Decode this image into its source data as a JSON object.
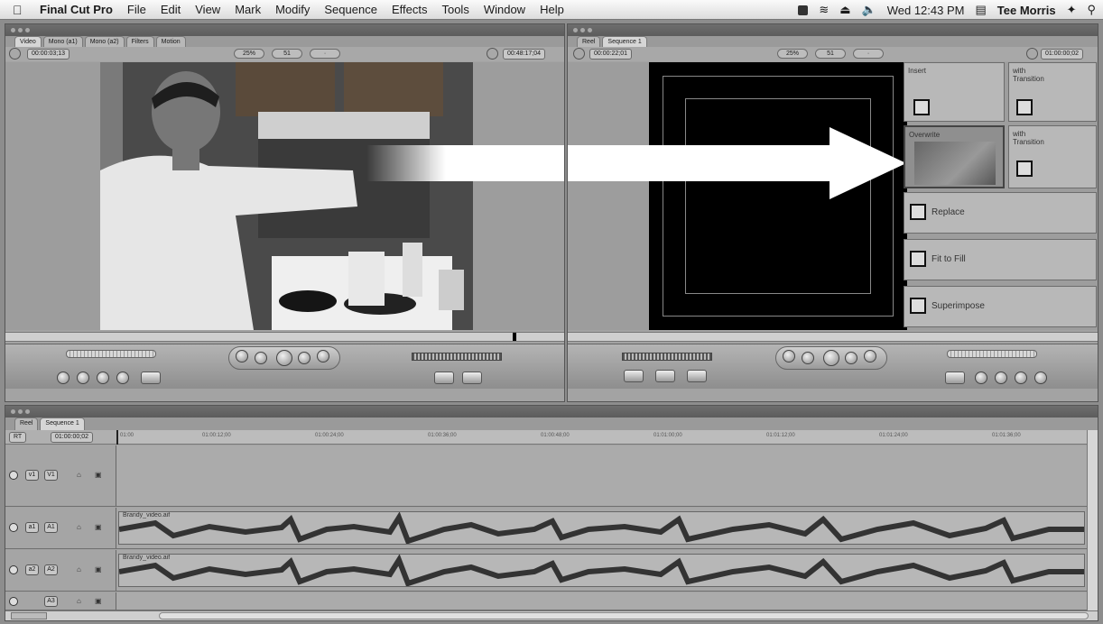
{
  "menubar": {
    "app_name": "Final Cut Pro",
    "items": [
      "File",
      "Edit",
      "View",
      "Mark",
      "Modify",
      "Sequence",
      "Effects",
      "Tools",
      "Window",
      "Help"
    ],
    "clock": "Wed 12:43 PM",
    "user": "Tee Morris"
  },
  "viewer": {
    "tabs": [
      "Video",
      "Mono (a1)",
      "Mono (a2)",
      "Filters",
      "Motion"
    ],
    "duration_tc": "00:00:03;13",
    "current_tc": "00:48:17;04",
    "zoom": "25%",
    "view_mode": "51",
    "overlay_mode": "· "
  },
  "canvas": {
    "tabs": [
      "Reel",
      "Sequence 1"
    ],
    "duration_tc": "00:00:22;01",
    "current_tc": "01:00:00;02",
    "zoom": "25%",
    "overlay": {
      "insert": "Insert",
      "insert_with_transition": "with Transition",
      "overwrite": "Overwrite",
      "overwrite_with_transition": "with Transition",
      "replace": "Replace",
      "fit_to_fill": "Fit to Fill",
      "superimpose": "Superimpose"
    }
  },
  "timeline": {
    "tabs": [
      "Reel",
      "Sequence 1"
    ],
    "current_tc": "01:00:00;02",
    "ruler_ticks": [
      "01:00",
      "01:00:12;00",
      "01:00:24;00",
      "01:00:36;00",
      "01:00:48;00",
      "01:01:00;00",
      "01:01:12;00",
      "01:01:24;00",
      "01:01:36;00"
    ],
    "tracks": [
      {
        "src": "v1",
        "dst": "V1"
      },
      {
        "src": "a1",
        "dst": "A1",
        "clip": "Brandy_video.aif"
      },
      {
        "src": "a2",
        "dst": "A2",
        "clip": "Brandy_video.aif"
      },
      {
        "src": "",
        "dst": "A3"
      }
    ]
  }
}
